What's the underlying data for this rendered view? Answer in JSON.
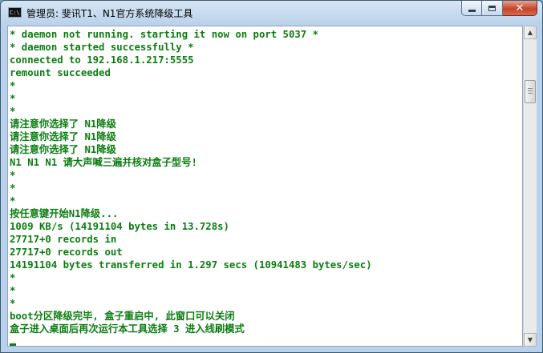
{
  "window": {
    "title": "管理员: 斐讯T1、N1官方系统降级工具",
    "icon": "console-icon",
    "icon_text": "C:\\"
  },
  "console": {
    "text_color": "#0b7d10",
    "background": "#ffffff",
    "lines": [
      "* daemon not running. starting it now on port 5037 *",
      "* daemon started successfully *",
      "connected to 192.168.1.217:5555",
      "remount succeeded",
      "*",
      "*",
      "*",
      "请注意你选择了 N1降级",
      "请注意你选择了 N1降级",
      "请注意你选择了 N1降级",
      "N1 N1 N1 请大声喊三遍并核对盒子型号!",
      "*",
      "*",
      "*",
      "按任意键开始N1降级...",
      "1009 KB/s (14191104 bytes in 13.728s)",
      "27717+0 records in",
      "27717+0 records out",
      "14191104 bytes transferred in 1.297 secs (10941483 bytes/sec)",
      "*",
      "*",
      "*",
      "boot分区降级完毕, 盒子重启中, 此窗口可以关闭",
      "盒子进入桌面后再次运行本工具选择 3 进入线刷模式"
    ]
  },
  "scrollbar": {
    "position_fraction": 0.15,
    "thumb_fraction": 0.08
  }
}
